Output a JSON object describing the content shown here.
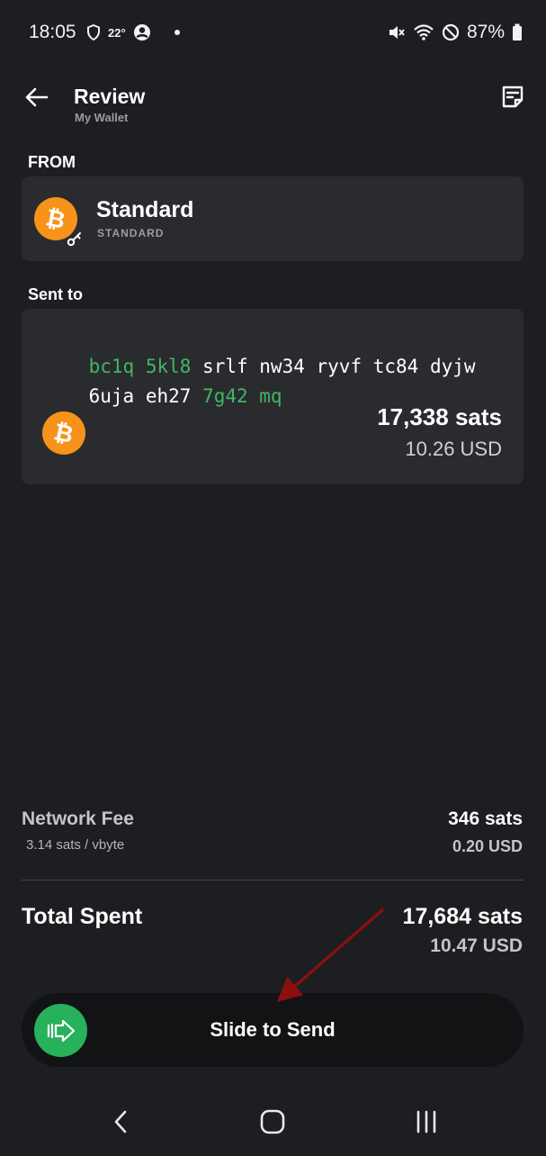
{
  "status_bar": {
    "time": "18:05",
    "temperature": "22°",
    "battery": "87%",
    "icons": [
      "shield-icon",
      "account-circle-icon",
      "mute-icon",
      "wifi-icon",
      "do-not-disturb-icon",
      "battery-icon"
    ]
  },
  "header": {
    "title": "Review",
    "subtitle": "My Wallet"
  },
  "from": {
    "label": "FROM",
    "wallet_name": "Standard",
    "wallet_type": "STANDARD"
  },
  "sent_to": {
    "label": "Sent to",
    "address_line1": [
      {
        "text": "bc1q",
        "highlight": true
      },
      {
        "text": "5kl8",
        "highlight": true
      },
      {
        "text": "srlf",
        "highlight": false
      },
      {
        "text": "nw34",
        "highlight": false
      },
      {
        "text": "ryvf",
        "highlight": false
      },
      {
        "text": "tc84",
        "highlight": false
      },
      {
        "text": "dyjw",
        "highlight": false
      }
    ],
    "address_line2": [
      {
        "text": "6uja",
        "highlight": false
      },
      {
        "text": "eh27",
        "highlight": false
      },
      {
        "text": "7g42",
        "highlight": true
      },
      {
        "text": "mq",
        "highlight": true
      }
    ],
    "amount_sats": "17,338 sats",
    "amount_usd": "10.26 USD"
  },
  "network_fee": {
    "label": "Network Fee",
    "rate": "3.14 sats / vbyte",
    "sats": "346 sats",
    "usd": "0.20 USD"
  },
  "total": {
    "label": "Total Spent",
    "sats": "17,684 sats",
    "usd": "10.47 USD"
  },
  "slider": {
    "label": "Slide to Send"
  },
  "colors": {
    "background": "#1d1e21",
    "card": "#2a2b2f",
    "bitcoin_orange": "#f7931a",
    "accent_green": "#27b15b",
    "address_green": "#3fb862",
    "annotation_arrow": "#8b0f0f"
  }
}
